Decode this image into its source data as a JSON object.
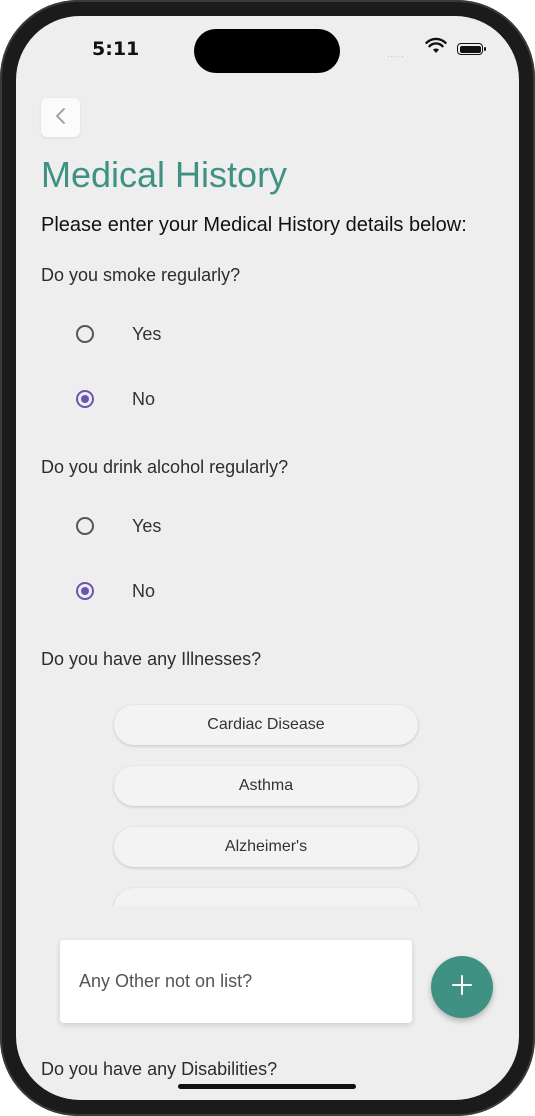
{
  "status_bar": {
    "time": "5:11",
    "signal": "....."
  },
  "header": {
    "title": "Medical History",
    "subtitle": "Please enter your Medical History details below:"
  },
  "questions": {
    "smoke": {
      "label": "Do you smoke regularly?",
      "options": [
        {
          "label": "Yes",
          "selected": false
        },
        {
          "label": "No",
          "selected": true
        }
      ]
    },
    "alcohol": {
      "label": "Do you drink alcohol regularly?",
      "options": [
        {
          "label": "Yes",
          "selected": false
        },
        {
          "label": "No",
          "selected": true
        }
      ]
    },
    "illnesses": {
      "label": "Do you have any Illnesses?",
      "items": [
        "Cardiac Disease",
        "Asthma",
        "Alzheimer's"
      ]
    },
    "other": {
      "placeholder": "Any Other not on list?"
    },
    "disabilities": {
      "label": "Do you have any Disabilities?"
    }
  },
  "colors": {
    "accent": "#3f9283",
    "radio_selected": "#6b55b2",
    "background": "#eeeeee"
  },
  "icons": {
    "back": "chevron-left-icon",
    "add": "plus-icon"
  }
}
